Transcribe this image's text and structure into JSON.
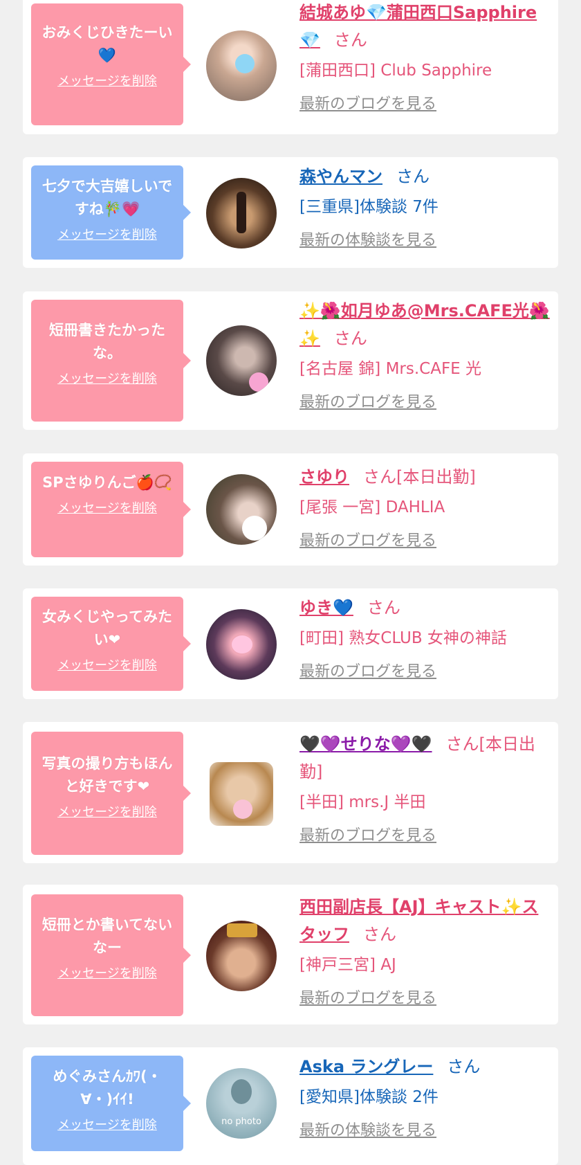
{
  "colors": {
    "page_bg": "#f0f0f0",
    "bubble_pink": "#fd99a9",
    "bubble_blue": "#8db7f7",
    "name_pink": "#e0406a",
    "name_blue": "#1766b8",
    "link_gray": "#8e8e8e"
  },
  "delete_label": "メッセージを削除",
  "cards": [
    {
      "message": "おみくじひきたーい💙",
      "name": "結城あゆ💎蒲田西口Sapphire💎",
      "san": "さん",
      "shop": "[蒲田西口] Club Sapphire",
      "link": "最新のブログを見る"
    },
    {
      "message": "七夕で大吉嬉しいですね🎋💗",
      "name": "森やんマン",
      "san": "さん",
      "shop": "[三重県]体験談 7件",
      "link": "最新の体験談を見る"
    },
    {
      "message": "短冊書きたかったな。",
      "name": "✨🌺如月ゆあ@Mrs.CAFE光🌺✨",
      "san": "さん",
      "shop": "[名古屋 錦] Mrs.CAFE 光",
      "link": "最新のブログを見る"
    },
    {
      "message": "SPさゆりんご🍎📿",
      "name": "さゆり",
      "san": "さん[本日出勤]",
      "shop": "[尾張 一宮] DAHLIA",
      "link": "最新のブログを見る"
    },
    {
      "message": "女みくじやってみたい❤",
      "name": "ゆき💙",
      "san": "さん",
      "shop": "[町田] 熟女CLUB 女神の神話",
      "link": "最新のブログを見る"
    },
    {
      "message": "写真の撮り方もほんと好きです❤",
      "name": "🖤💜せりな💜🖤",
      "san": "さん[本日出勤]",
      "shop": "[半田] mrs.J 半田",
      "link": "最新のブログを見る"
    },
    {
      "message": "短冊とか書いてないなー",
      "name": "西田副店長【AJ】キャスト✨スタッフ",
      "san": "さん",
      "shop": "[神戸三宮] AJ",
      "link": "最新のブログを見る"
    },
    {
      "message": "めぐみさんｶﾜ(・∀・)ｲｲ!",
      "name": "Aska ラングレー",
      "san": "さん",
      "shop": "[愛知県]体験談 2件",
      "link": "最新の体験談を見る",
      "avatar_text": "no photo"
    }
  ]
}
